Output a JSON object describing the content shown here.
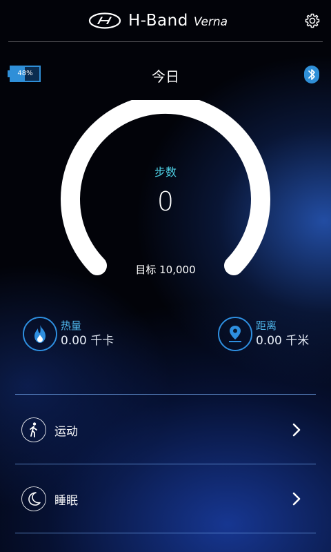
{
  "header": {
    "brand_name": "H-Band",
    "brand_sub": "Verna",
    "logo_icon": "hyundai-logo",
    "settings_icon": "gear-icon"
  },
  "status": {
    "battery_percent": "48%",
    "battery_level": 0.48,
    "bluetooth_icon": "bluetooth-icon",
    "day_label": "今日"
  },
  "steps": {
    "label": "步数",
    "value": "0",
    "goal": "目标 10,000"
  },
  "stats": {
    "calories": {
      "label": "热量",
      "value": "0.00 千卡",
      "icon": "flame-icon"
    },
    "distance": {
      "label": "距离",
      "value": "0.00 千米",
      "icon": "location-pin-icon"
    }
  },
  "menu": [
    {
      "label": "运动",
      "icon": "walking-person-icon"
    },
    {
      "label": "睡眠",
      "icon": "moon-icon"
    }
  ],
  "colors": {
    "accent": "#2e8fe0",
    "label_cyan": "#4fd1e6",
    "battery": "#2f8fd8",
    "gauge_arc": "#ffffff"
  }
}
